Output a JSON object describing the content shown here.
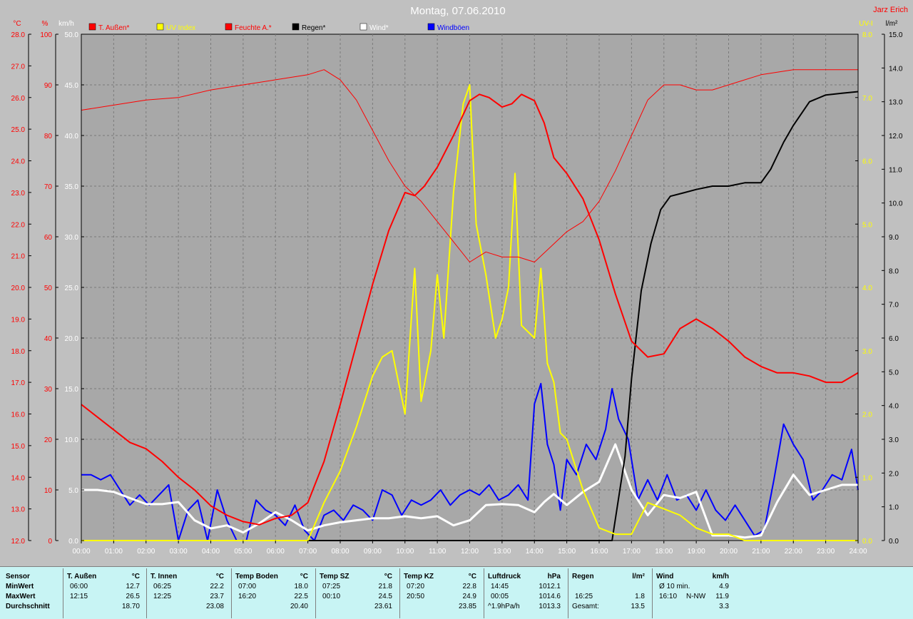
{
  "title": "Montag, 07.06.2010",
  "author": "Jarz Erich",
  "colors": {
    "bg": "#c0c0c0",
    "plot": "#a8a8a8",
    "red": "#ff0000",
    "yellow": "#ffff00",
    "black": "#000000",
    "white": "#ffffff",
    "blue": "#0000ff"
  },
  "chart_data": {
    "type": "line",
    "title": "Montag, 07.06.2010",
    "grid": true,
    "legend_position": "top",
    "x_ticks": [
      "00:00",
      "01:00",
      "02:00",
      "03:00",
      "04:00",
      "05:00",
      "06:00",
      "07:00",
      "08:00",
      "09:00",
      "10:00",
      "11:00",
      "12:00",
      "13:00",
      "14:00",
      "15:00",
      "16:00",
      "17:00",
      "18:00",
      "19:00",
      "20:00",
      "21:00",
      "22:00",
      "23:00",
      "24:00"
    ],
    "axes": {
      "temp": {
        "unit": "°C",
        "ticks": [
          "12.0",
          "13.0",
          "14.0",
          "15.0",
          "16.0",
          "17.0",
          "18.0",
          "19.0",
          "20.0",
          "21.0",
          "22.0",
          "23.0",
          "24.0",
          "25.0",
          "26.0",
          "27.0",
          "28.0"
        ],
        "ylim": [
          12,
          28
        ]
      },
      "humidity": {
        "unit": "%",
        "ticks": [
          "0",
          "10",
          "20",
          "30",
          "40",
          "50",
          "60",
          "70",
          "80",
          "90",
          "100"
        ],
        "ylim": [
          0,
          100
        ]
      },
      "wind": {
        "unit": "km/h",
        "ticks": [
          "0.0",
          "5.0",
          "10.0",
          "15.0",
          "20.0",
          "25.0",
          "30.0",
          "35.0",
          "40.0",
          "45.0",
          "50.0"
        ],
        "ylim": [
          0,
          50
        ]
      },
      "uv": {
        "unit": "UV-I",
        "ticks": [
          "0.0",
          "1.0",
          "2.0",
          "3.0",
          "4.0",
          "5.0",
          "6.0",
          "7.0",
          "8.0"
        ],
        "ylim": [
          0,
          8
        ]
      },
      "rain": {
        "unit": "l/m²",
        "ticks": [
          "0.0",
          "1.0",
          "2.0",
          "3.0",
          "4.0",
          "5.0",
          "6.0",
          "7.0",
          "8.0",
          "9.0",
          "10.0",
          "11.0",
          "12.0",
          "13.0",
          "14.0",
          "15.0"
        ],
        "ylim": [
          0,
          15
        ]
      }
    },
    "legend": [
      {
        "label": "T. Außen*",
        "color": "#ff0000"
      },
      {
        "label": "UV Index",
        "color": "#ffff00"
      },
      {
        "label": "Feuchte A.*",
        "color": "#ff0000"
      },
      {
        "label": "Regen*",
        "color": "#000000"
      },
      {
        "label": "Wind*",
        "color": "#ffffff"
      },
      {
        "label": "Windböen",
        "color": "#0000ff"
      }
    ],
    "series": [
      {
        "name": "T. Außen*",
        "axis": "temp",
        "x": [
          0,
          0.5,
          1,
          1.5,
          2,
          2.5,
          3,
          3.5,
          4,
          4.5,
          5,
          5.5,
          6,
          6.5,
          7,
          7.5,
          8,
          8.5,
          9,
          9.5,
          10,
          10.3,
          10.6,
          11,
          11.5,
          12,
          12.3,
          12.6,
          13,
          13.3,
          13.6,
          14,
          14.3,
          14.6,
          15,
          15.5,
          16,
          16.5,
          17,
          17.5,
          18,
          18.5,
          19,
          19.5,
          20,
          20.5,
          21,
          21.5,
          22,
          22.5,
          23,
          23.5,
          24
        ],
        "y": [
          16.3,
          15.9,
          15.5,
          15.1,
          14.9,
          14.5,
          14.0,
          13.6,
          13.1,
          12.8,
          12.6,
          12.5,
          12.7,
          12.8,
          13.2,
          14.5,
          16.3,
          18.2,
          20.1,
          21.8,
          23.0,
          22.9,
          23.2,
          23.8,
          24.8,
          25.9,
          26.1,
          26.0,
          25.7,
          25.8,
          26.1,
          25.9,
          25.2,
          24.1,
          23.6,
          22.8,
          21.5,
          19.8,
          18.3,
          17.8,
          17.9,
          18.7,
          19.0,
          18.7,
          18.3,
          17.8,
          17.5,
          17.3,
          17.3,
          17.2,
          17.0,
          17.0,
          17.3
        ]
      },
      {
        "name": "Feuchte A.*",
        "axis": "humidity",
        "x": [
          0,
          1,
          2,
          3,
          4,
          5,
          6,
          7,
          7.5,
          8,
          8.5,
          9,
          9.5,
          10,
          10.5,
          11,
          11.5,
          12,
          12.5,
          13,
          13.5,
          14,
          14.5,
          15,
          15.5,
          16,
          16.5,
          17,
          17.5,
          18,
          18.5,
          19,
          19.5,
          20,
          21,
          22,
          23,
          24
        ],
        "y": [
          85,
          86,
          87,
          87.5,
          89,
          90,
          91,
          92,
          93,
          91,
          87,
          81,
          75,
          70,
          67,
          63,
          59,
          55,
          57,
          56,
          56,
          55,
          58,
          61,
          63,
          67,
          73,
          80,
          87,
          90,
          90,
          89,
          89,
          90,
          92,
          93,
          93,
          93
        ]
      },
      {
        "name": "UV Index",
        "axis": "uv",
        "x": [
          0,
          7,
          7.5,
          8,
          8.5,
          9,
          9.3,
          9.6,
          10,
          10.3,
          10.5,
          10.8,
          11,
          11.2,
          11.5,
          11.8,
          12,
          12.2,
          12.5,
          12.8,
          13,
          13.2,
          13.4,
          13.6,
          14,
          14.2,
          14.4,
          14.6,
          14.8,
          15,
          15.5,
          16,
          16.5,
          17,
          17.5,
          18,
          18.5,
          19,
          19.5,
          20,
          20.5,
          21,
          22,
          23,
          24
        ],
        "y": [
          0,
          0,
          0.6,
          1.1,
          1.8,
          2.6,
          2.9,
          3.0,
          2.0,
          4.3,
          2.2,
          3.0,
          4.2,
          3.2,
          5.5,
          6.9,
          7.2,
          5.0,
          4.2,
          3.2,
          3.5,
          4.0,
          5.8,
          3.4,
          3.2,
          4.3,
          2.8,
          2.5,
          1.7,
          1.6,
          0.8,
          0.2,
          0.1,
          0.1,
          0.6,
          0.5,
          0.4,
          0.2,
          0.1,
          0.1,
          0,
          0,
          0,
          0,
          0
        ]
      },
      {
        "name": "Regen*",
        "axis": "rain",
        "x": [
          0,
          16.4,
          16.8,
          17,
          17.3,
          17.6,
          17.9,
          18.2,
          18.6,
          19,
          19.5,
          20,
          20.5,
          21,
          21.3,
          21.7,
          22,
          22.5,
          23,
          23.5,
          24
        ],
        "y": [
          0,
          0,
          2.5,
          4.8,
          7.4,
          8.8,
          9.8,
          10.2,
          10.3,
          10.4,
          10.5,
          10.5,
          10.6,
          10.6,
          11.0,
          11.8,
          12.3,
          13.0,
          13.2,
          13.25,
          13.3
        ]
      },
      {
        "name": "Wind*",
        "axis": "wind",
        "x": [
          0,
          0.5,
          1,
          1.5,
          2,
          2.5,
          3,
          3.5,
          4,
          4.5,
          5,
          5.5,
          6,
          6.5,
          7,
          7.5,
          8,
          8.5,
          9,
          9.5,
          10,
          10.5,
          11,
          11.5,
          12,
          12.5,
          13,
          13.5,
          14,
          14.3,
          14.6,
          15,
          15.5,
          16,
          16.5,
          17,
          17.5,
          18,
          18.5,
          19,
          19.5,
          20,
          20.5,
          21,
          21.5,
          22,
          22.5,
          23,
          23.5,
          24
        ],
        "y": [
          5.0,
          5.0,
          4.8,
          4.2,
          3.6,
          3.6,
          3.8,
          2.0,
          1.2,
          1.5,
          0.8,
          1.7,
          2.8,
          2.0,
          1.0,
          1.5,
          1.8,
          2.0,
          2.2,
          2.2,
          2.4,
          2.2,
          2.4,
          1.5,
          2.0,
          3.5,
          3.6,
          3.5,
          2.8,
          3.8,
          4.6,
          3.5,
          4.8,
          5.8,
          9.5,
          5.0,
          2.5,
          4.5,
          4.2,
          4.8,
          0.5,
          0.5,
          0.3,
          0.5,
          3.8,
          6.5,
          4.5,
          5.0,
          5.5,
          5.5
        ]
      },
      {
        "name": "Windböen",
        "axis": "wind",
        "x": [
          0,
          0.3,
          0.6,
          0.9,
          1.2,
          1.5,
          1.8,
          2.1,
          2.4,
          2.7,
          3.0,
          3.3,
          3.6,
          3.9,
          4.2,
          4.5,
          4.8,
          5.1,
          5.4,
          5.7,
          6.0,
          6.3,
          6.6,
          6.9,
          7.2,
          7.5,
          7.8,
          8.1,
          8.4,
          8.7,
          9.0,
          9.3,
          9.6,
          9.9,
          10.2,
          10.5,
          10.8,
          11.1,
          11.4,
          11.7,
          12.0,
          12.3,
          12.6,
          12.9,
          13.2,
          13.5,
          13.8,
          14.0,
          14.2,
          14.4,
          14.6,
          14.8,
          15.0,
          15.3,
          15.6,
          15.9,
          16.2,
          16.4,
          16.6,
          16.9,
          17.2,
          17.5,
          17.8,
          18.1,
          18.4,
          18.7,
          19.0,
          19.3,
          19.6,
          19.9,
          20.2,
          20.5,
          20.8,
          21.1,
          21.4,
          21.7,
          22.0,
          22.3,
          22.6,
          22.9,
          23.2,
          23.5,
          23.8,
          24.0
        ],
        "y": [
          6.5,
          6.5,
          6.0,
          6.5,
          5.0,
          3.5,
          4.5,
          3.5,
          4.5,
          5.5,
          0.0,
          3.0,
          4.0,
          0.0,
          5.0,
          2.0,
          0.0,
          0.0,
          4.0,
          3.0,
          2.5,
          1.5,
          3.5,
          1.0,
          0.0,
          2.5,
          3.0,
          2.0,
          3.5,
          3.0,
          2.0,
          5.0,
          4.5,
          2.5,
          4.0,
          3.5,
          4.0,
          5.0,
          3.5,
          4.5,
          5.0,
          4.5,
          5.5,
          4.0,
          4.5,
          5.5,
          4.0,
          13.5,
          15.5,
          9.5,
          7.5,
          3.0,
          8.0,
          6.5,
          9.5,
          8.0,
          11.0,
          15.0,
          12.0,
          10.0,
          4.0,
          6.0,
          4.0,
          6.5,
          4.0,
          4.5,
          3.0,
          5.0,
          3.0,
          2.0,
          3.5,
          2.0,
          0.5,
          1.0,
          6.0,
          11.5,
          9.5,
          8.0,
          4.0,
          5.0,
          6.5,
          6.0,
          9.0,
          5.0
        ]
      }
    ]
  },
  "stats": {
    "label_col": {
      "sensor": "Sensor",
      "min": "MinWert",
      "max": "MaxWert",
      "avg": "Durchschnitt"
    },
    "sensors": [
      {
        "name": "T. Außen",
        "unit": "°C",
        "min_time": "06:00",
        "min_val": "12.7",
        "max_time": "12:15",
        "max_val": "26.5",
        "avg": "18.70"
      },
      {
        "name": "T. Innen",
        "unit": "°C",
        "min_time": "06:25",
        "min_val": "22.2",
        "max_time": "12:25",
        "max_val": "23.7",
        "avg": "23.08"
      },
      {
        "name": "Temp Boden",
        "unit": "°C",
        "min_time": "07:00",
        "min_val": "18.0",
        "max_time": "16:20",
        "max_val": "22.5",
        "avg": "20.40"
      },
      {
        "name": "Temp SZ",
        "unit": "°C",
        "min_time": "07:25",
        "min_val": "21.8",
        "max_time": "00:10",
        "max_val": "24.5",
        "avg": "23.61"
      },
      {
        "name": "Temp KZ",
        "unit": "°C",
        "min_time": "07:20",
        "min_val": "22.8",
        "max_time": "20:50",
        "max_val": "24.9",
        "avg": "23.85"
      },
      {
        "name": "Luftdruck",
        "unit": "hPa",
        "min_time": "14:45",
        "min_val": "1012.1",
        "max_time": "00:05",
        "max_val": "1014.6",
        "avg_label": "^1.9hPa/h",
        "avg": "1013.3"
      },
      {
        "name": "Regen",
        "unit": "l/m²",
        "min_time": "",
        "min_val": "",
        "max_time": "16:25",
        "max_val": "1.8",
        "avg_label": "Gesamt:",
        "avg": "13.5"
      },
      {
        "name": "Wind",
        "unit": "km/h",
        "min_time": "Ø 10 min.",
        "min_val": "4.9",
        "max_time": "16:10",
        "max_dir": "N-NW",
        "max_val": "11.9",
        "avg": "3.3"
      }
    ]
  }
}
